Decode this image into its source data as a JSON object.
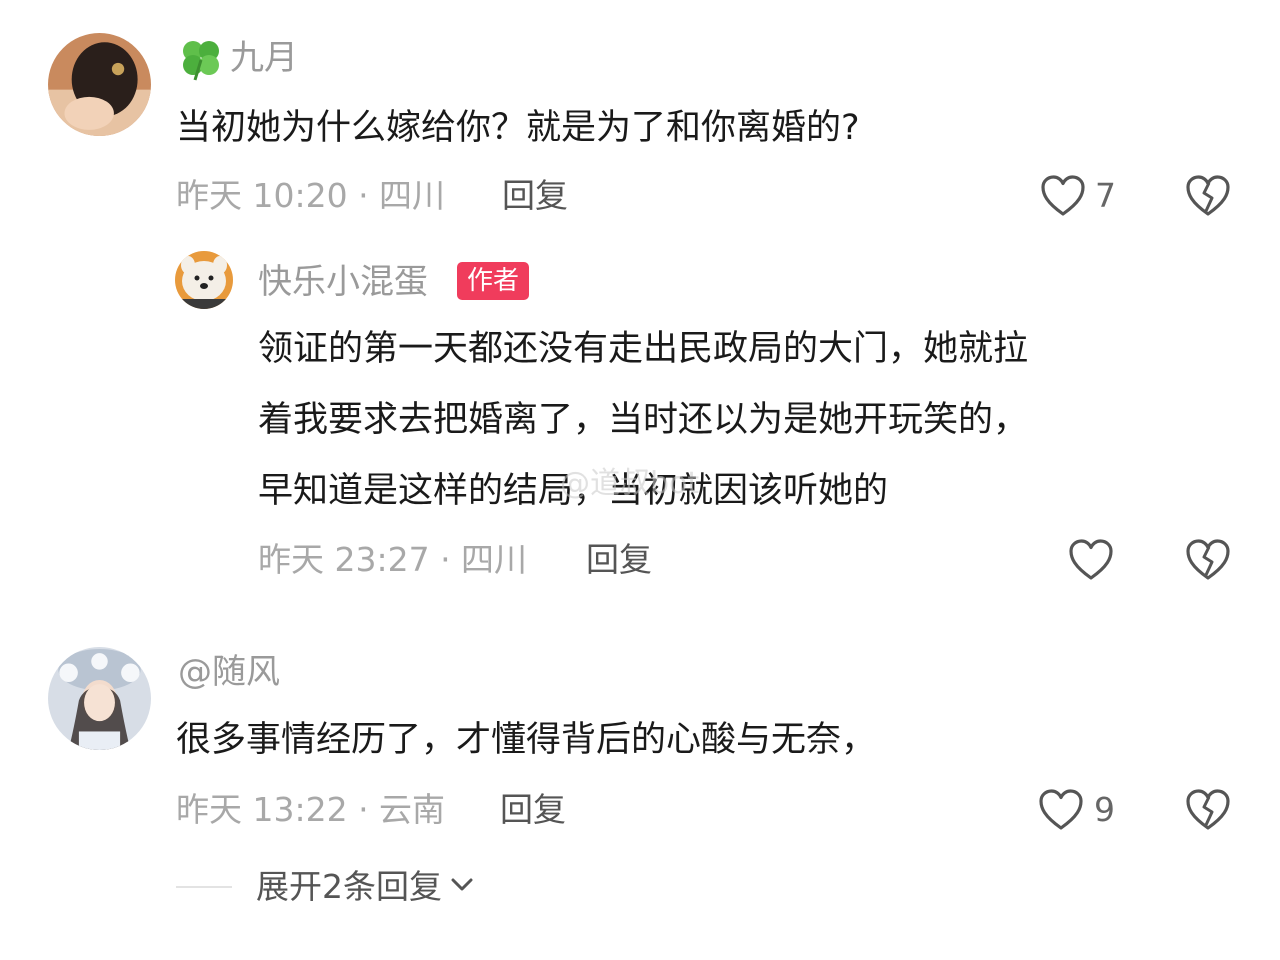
{
  "comments": [
    {
      "username": "九月",
      "username_prefix_icon": "four-leaf-clover-icon",
      "content": "当初她为什么嫁给你？就是为了和你离婚的?",
      "meta": "昨天 10:20 · 四川",
      "reply_label": "回复",
      "likes": "7"
    },
    {
      "username": "@随风",
      "content": "很多事情经历了，才懂得背后的心酸与无奈，",
      "meta": "昨天 13:22 · 云南",
      "reply_label": "回复",
      "likes": "9"
    }
  ],
  "reply": {
    "username": "快乐小混蛋",
    "badge": "作者",
    "lines": [
      "领证的第一天都还没有走出民政局的大门，她就拉",
      "着我要求去把婚离了，当时还以为是她开玩笑的，",
      "早知道是这样的结局，当初就因该听她的"
    ],
    "meta": "昨天 23:27 · 四川",
    "reply_label": "回复"
  },
  "expand_replies": "展开2条回复",
  "watermark": "@道叔bot",
  "colors": {
    "author_badge": "#f03c5c",
    "text": "#1a1a1a",
    "muted": "#a8a8a8"
  }
}
